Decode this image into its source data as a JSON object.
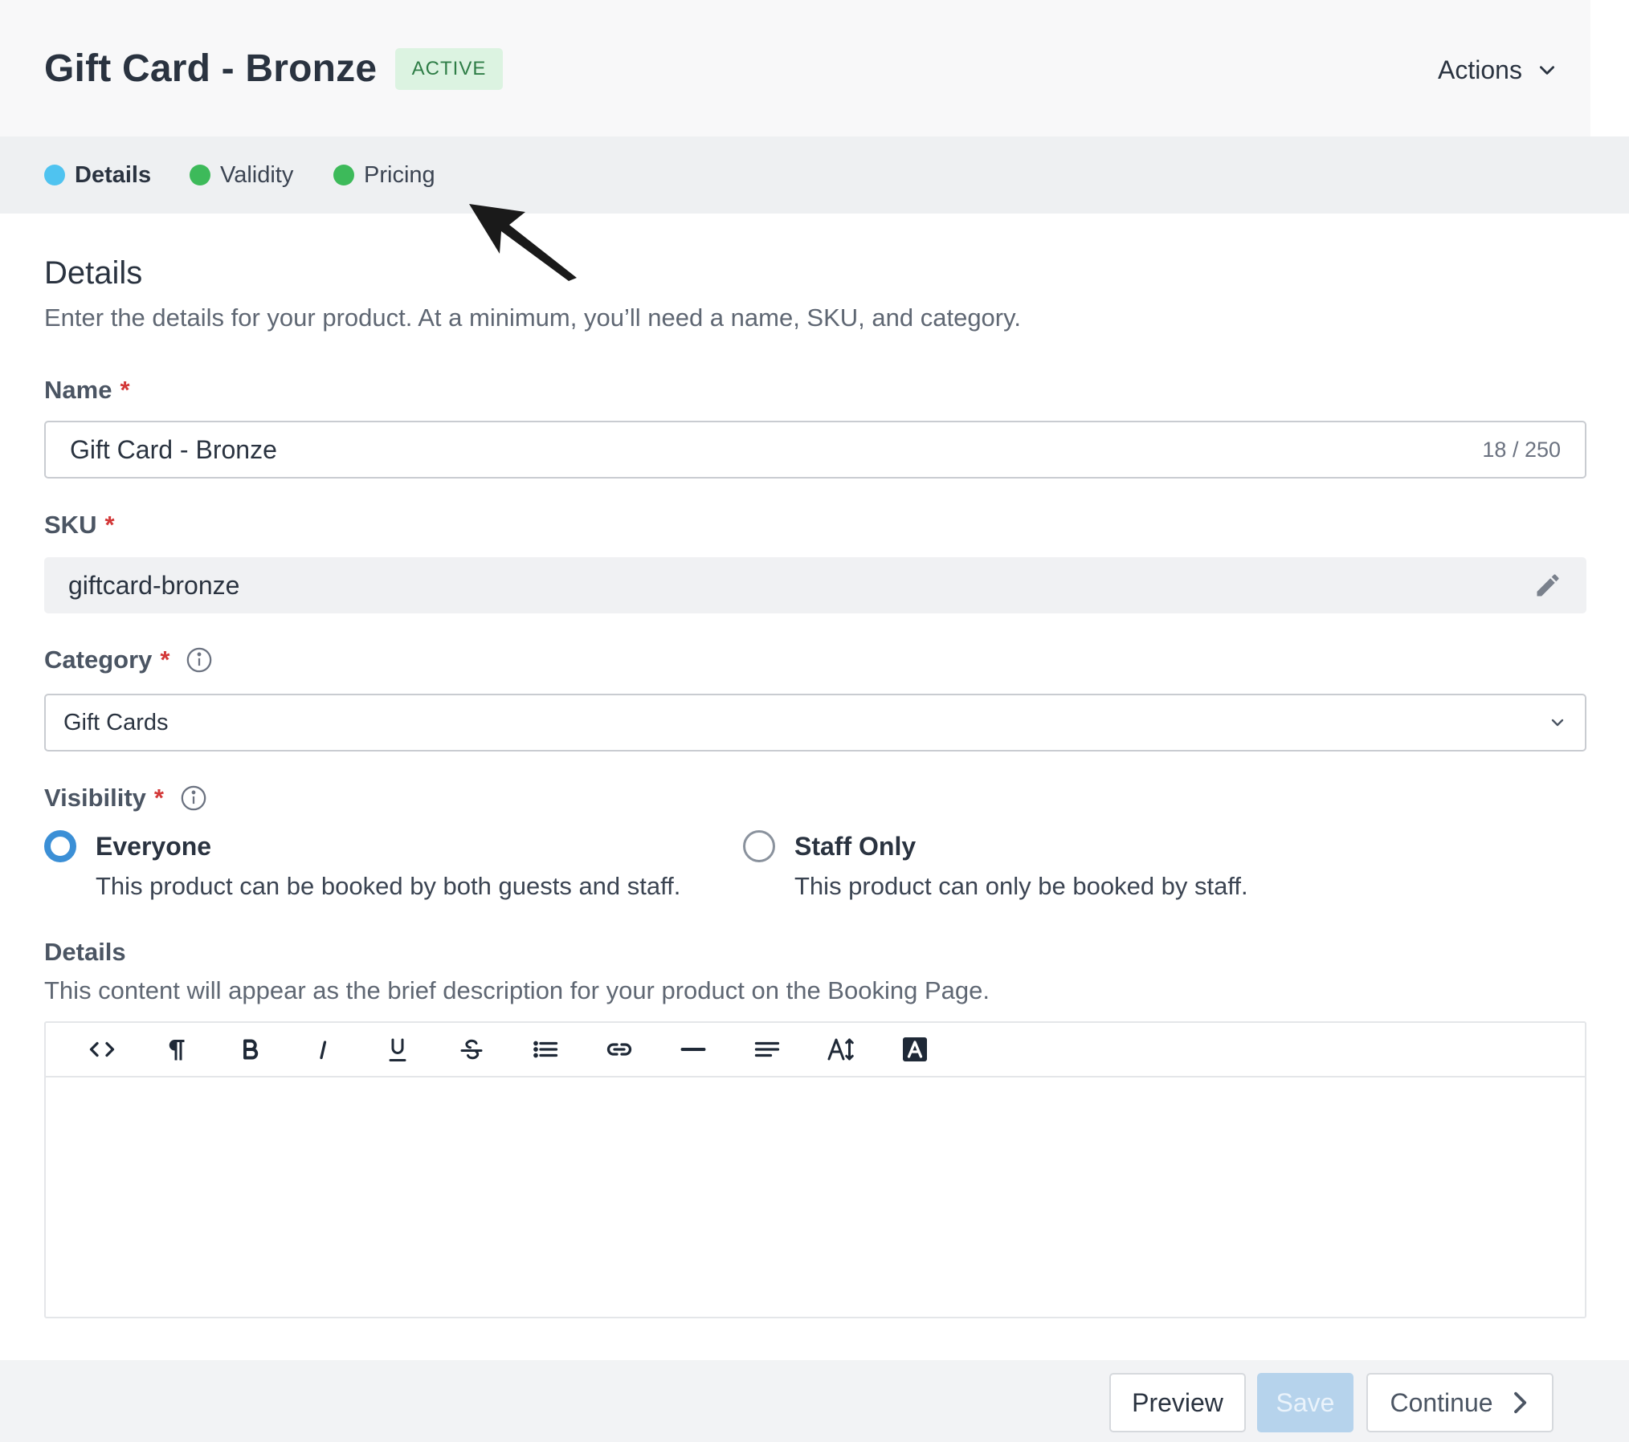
{
  "header": {
    "title": "Gift Card - Bronze",
    "status": "ACTIVE",
    "actions_label": "Actions"
  },
  "tabs": [
    {
      "label": "Details",
      "active": true,
      "dot_color": "#4fc3f0"
    },
    {
      "label": "Validity",
      "active": false,
      "dot_color": "#3dba5a"
    },
    {
      "label": "Pricing",
      "active": false,
      "dot_color": "#3dba5a"
    }
  ],
  "section": {
    "title": "Details",
    "description": "Enter the details for your product. At a minimum, you’ll need a name, SKU, and category."
  },
  "fields": {
    "name": {
      "label": "Name",
      "required_mark": "*",
      "value": "Gift Card - Bronze",
      "char_count": "18 / 250"
    },
    "sku": {
      "label": "SKU",
      "required_mark": "*",
      "value": "giftcard-bronze"
    },
    "category": {
      "label": "Category",
      "required_mark": "*",
      "value": "Gift Cards"
    },
    "visibility": {
      "label": "Visibility",
      "required_mark": "*",
      "options": [
        {
          "title": "Everyone",
          "description": "This product can be booked by both guests and staff.",
          "checked": true
        },
        {
          "title": "Staff Only",
          "description": "This product can only be booked by staff.",
          "checked": false
        }
      ]
    },
    "details": {
      "label": "Details",
      "description": "This content will appear as the brief description for your product on the Booking Page.",
      "toolbar": [
        "code-view-icon",
        "paragraph-icon",
        "bold-icon",
        "italic-icon",
        "underline-icon",
        "strikethrough-icon",
        "list-icon",
        "link-icon",
        "horizontal-rule-icon",
        "align-icon",
        "font-size-icon",
        "font-color-icon"
      ]
    }
  },
  "footer": {
    "preview_label": "Preview",
    "save_label": "Save",
    "continue_label": "Continue"
  },
  "colors": {
    "accent": "#3b8fd6",
    "required": "#d33838",
    "active_badge_bg": "#dcf3e1",
    "active_badge_text": "#2e7d46"
  }
}
